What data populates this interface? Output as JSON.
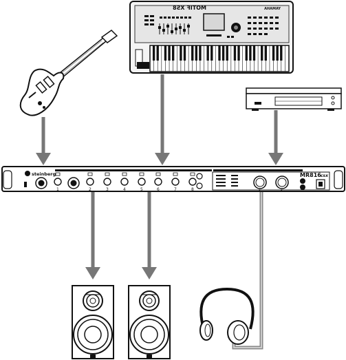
{
  "keyboard": {
    "brand": "YAMAHA",
    "model_mirrored": "MOTIF XS8"
  },
  "interface": {
    "brand": "steinberg",
    "model": "MR816",
    "model_suffix": "csx",
    "channel_numbers": [
      "1",
      "2",
      "3",
      "4",
      "5",
      "6",
      "7",
      "8"
    ],
    "knob_numbers": [
      "1",
      "2"
    ]
  },
  "colors": {
    "arrow": "#777777",
    "line": "#111111",
    "cable": "#999999"
  }
}
